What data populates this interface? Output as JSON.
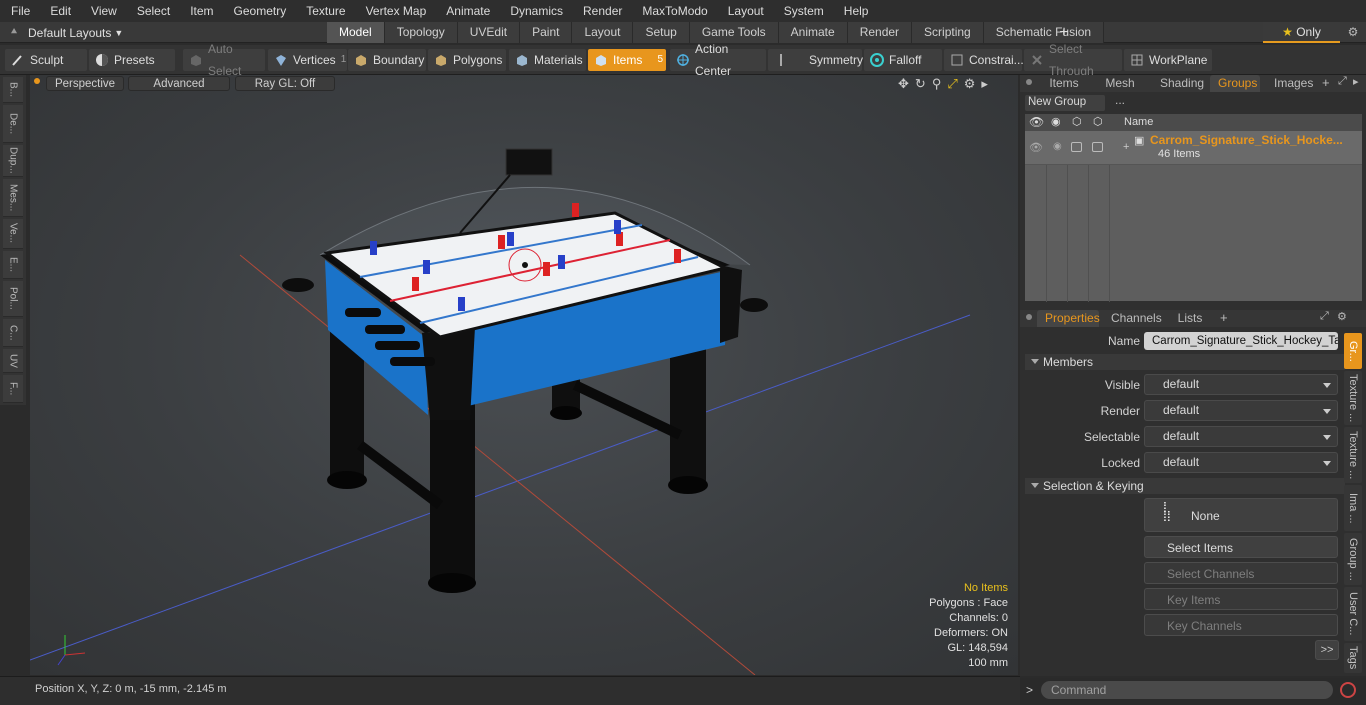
{
  "menu": [
    "File",
    "Edit",
    "View",
    "Select",
    "Item",
    "Geometry",
    "Texture",
    "Vertex Map",
    "Animate",
    "Dynamics",
    "Render",
    "MaxToModo",
    "Layout",
    "System",
    "Help"
  ],
  "layout_dropdown": "Default Layouts",
  "mode_tabs": [
    "Model",
    "Topology",
    "UVEdit",
    "Paint",
    "Layout",
    "Setup",
    "Game Tools",
    "Animate",
    "Render",
    "Scripting",
    "Schematic Fusion"
  ],
  "mode_plus": "+",
  "only_label": "Only",
  "toolbar": {
    "sculpt": "Sculpt",
    "presets": "Presets",
    "auto_select": "Auto Select",
    "vertices": "Vertices",
    "vertices_count": "1",
    "boundary": "Boundary",
    "polygons": "Polygons",
    "materials": "Materials",
    "items": "Items",
    "items_count": "5",
    "action_center": "Action Center",
    "symmetry": "Symmetry",
    "falloff": "Falloff",
    "constraints": "Constrai...",
    "select_through": "Select Through",
    "workplane": "WorkPlane"
  },
  "left_tabs": [
    "B...",
    "De...",
    "Dup...",
    "Mes...",
    "Ve...",
    "E...",
    "Pol...",
    "C...",
    "UV",
    "F..."
  ],
  "viewport": {
    "view": "Perspective",
    "shading": "Advanced",
    "raygl": "Ray GL: Off",
    "stats": [
      "No Items",
      "Polygons : Face",
      "Channels: 0",
      "Deformers: ON",
      "GL: 148,594",
      "100 mm"
    ]
  },
  "status": {
    "position": "Position X, Y, Z:   0 m, -15 mm, -2.145 m"
  },
  "groups_panel": {
    "tabs": [
      "Items",
      "Mesh ...",
      "Shading",
      "Groups",
      "Images"
    ],
    "active_tab": "Groups",
    "new_group": "New Group",
    "col_name": "Name",
    "group_name": "Carrom_Signature_Stick_Hocke...",
    "group_count": "46 Items"
  },
  "properties_panel": {
    "tabs": [
      "Properties",
      "Channels",
      "Lists"
    ],
    "name_label": "Name",
    "name_value": "Carrom_Signature_Stick_Hockey_Tabl",
    "members": "Members",
    "fields": [
      {
        "label": "Visible",
        "value": "default"
      },
      {
        "label": "Render",
        "value": "default"
      },
      {
        "label": "Selectable",
        "value": "default"
      },
      {
        "label": "Locked",
        "value": "default"
      }
    ],
    "selection_keying": "Selection & Keying",
    "none": "None",
    "select_items": "Select Items",
    "select_channels": "Select Channels",
    "key_items": "Key Items",
    "key_channels": "Key Channels",
    "more": ">>",
    "side_tabs": [
      "Gr...",
      "Texture ...",
      "Texture ...",
      "Ima ...",
      "Group ...",
      "User C...",
      "Tags"
    ]
  },
  "command": {
    "placeholder": "Command",
    "prompt": ">"
  },
  "colors": {
    "accent": "#e8961d",
    "table_blue": "#1a73c9"
  }
}
